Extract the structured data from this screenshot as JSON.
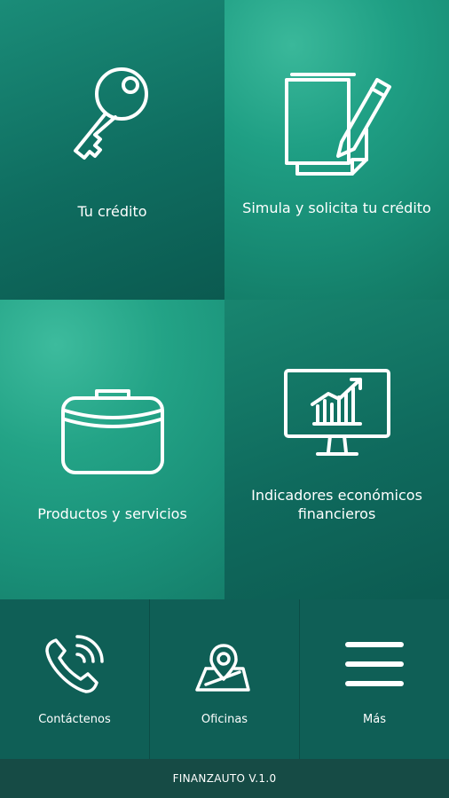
{
  "tiles": [
    {
      "label": "Tu crédito",
      "icon": "key-icon"
    },
    {
      "label": "Simula y solicita tu crédito",
      "icon": "document-pencil-icon"
    },
    {
      "label": "Productos y servicios",
      "icon": "briefcase-icon"
    },
    {
      "label": "Indicadores económicos financieros",
      "icon": "monitor-chart-icon"
    }
  ],
  "bottom_nav": [
    {
      "label": "Contáctenos",
      "icon": "phone-icon"
    },
    {
      "label": "Oficinas",
      "icon": "map-pin-icon"
    },
    {
      "label": "Más",
      "icon": "menu-icon"
    }
  ],
  "footer": {
    "version": "FINANZAUTO V.1.0"
  },
  "colors": {
    "primary": "#1a9179",
    "dark": "#0f5f56",
    "footer": "#164b45",
    "text": "#ffffff"
  }
}
